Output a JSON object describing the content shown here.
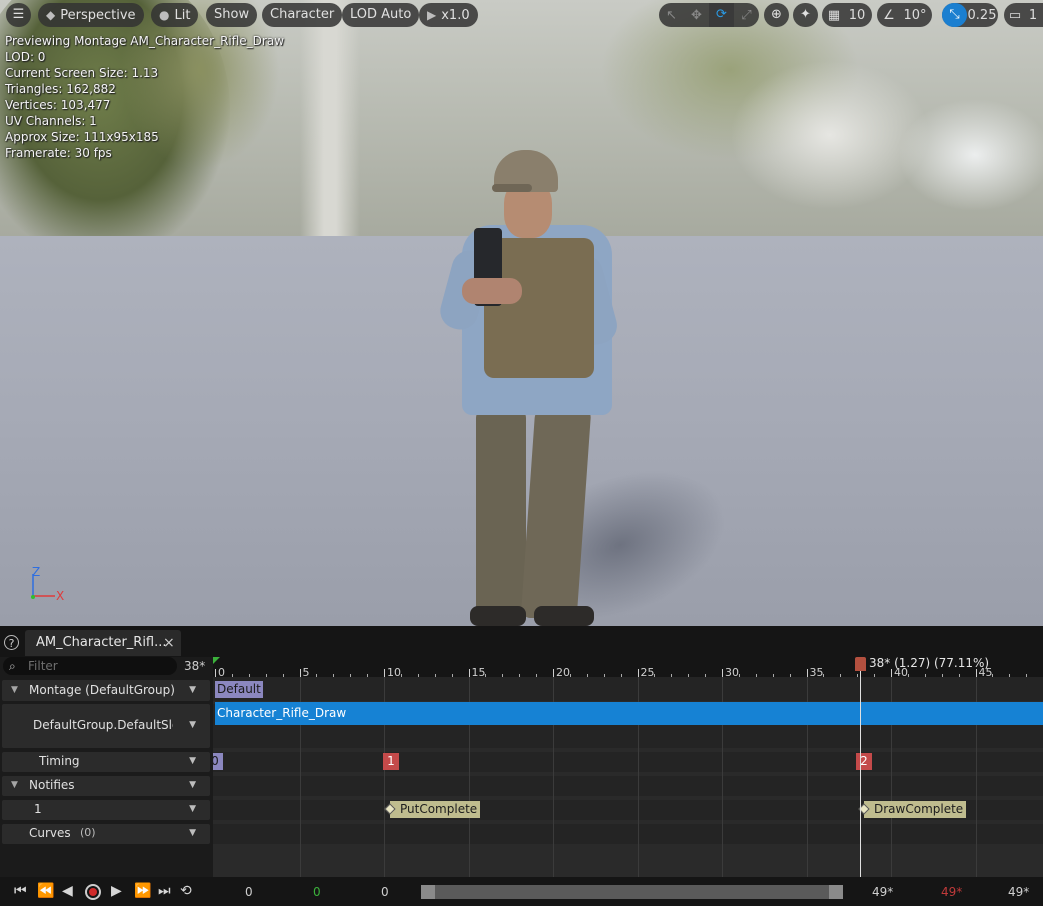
{
  "toolbar": {
    "perspective": "Perspective",
    "lit": "Lit",
    "show": "Show",
    "character": "Character",
    "lod": "LOD Auto",
    "play_rate": "x1.0",
    "grid_size": "10",
    "rotation_snap": "10°",
    "scale_snap": "0.25",
    "camera_speed": "1"
  },
  "stats": {
    "line1": "Previewing Montage AM_Character_Rifle_Draw",
    "line2": "LOD: 0",
    "line3": "Current Screen Size: 1.13",
    "line4": "Triangles: 162,882",
    "line5": "Vertices: 103,477",
    "line6": "UV Channels: 1",
    "line7": "Approx Size: 111x95x185",
    "line8": "Framerate: 30 fps"
  },
  "axis": {
    "z": "Z",
    "x": "X"
  },
  "tab": {
    "title": "AM_Character_Rifl...",
    "close": "×",
    "help": "?"
  },
  "filter": {
    "placeholder": "Filter",
    "frame": "38*"
  },
  "tracks": {
    "montage": "Montage (DefaultGroup)",
    "slot": "DefaultGroup.DefaultSlot",
    "timing": "Timing",
    "notifies": "Notifies",
    "notify_track": "1",
    "curves": "Curves",
    "curves_count": "(0)"
  },
  "ruler": {
    "ticks": [
      "0",
      "5",
      "10",
      "15",
      "20",
      "25",
      "30",
      "35",
      "40",
      "45"
    ],
    "playhead": "38* (1.27) (77.11%)"
  },
  "montage": {
    "section": "Default",
    "segment": "Character_Rifle_Draw",
    "sections": [
      "0",
      "1",
      "2"
    ],
    "notifies": [
      "PutComplete",
      "DrawComplete"
    ]
  },
  "transport": {
    "start": "0",
    "start_green": "0",
    "view_start": "0",
    "view_end": "49*",
    "end_red": "49*",
    "end": "49*"
  },
  "colors": {
    "accent_blue": "#1682d4",
    "default_section": "#8b87bf",
    "section_marker": "#c44a4a",
    "notify": "#bfbc8e",
    "playhead": "#b3503f"
  }
}
